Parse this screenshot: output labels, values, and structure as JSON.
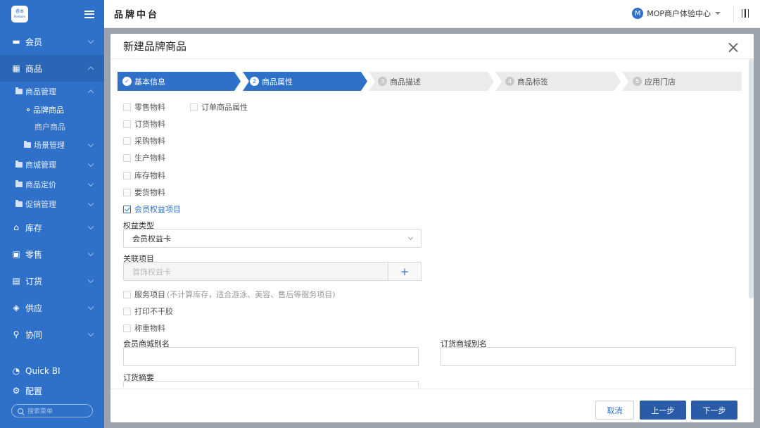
{
  "sidebar": {
    "logo_text_top": "睿本",
    "logo_text_bottom": "Reebom",
    "items": [
      {
        "label": "会员",
        "icon": "card-icon"
      },
      {
        "label": "商品",
        "icon": "grid-icon"
      },
      {
        "label": "库存",
        "icon": "warehouse-icon"
      },
      {
        "label": "零售",
        "icon": "store-icon"
      },
      {
        "label": "订货",
        "icon": "document-icon"
      },
      {
        "label": "供应",
        "icon": "layers-icon"
      },
      {
        "label": "协同",
        "icon": "collab-icon"
      }
    ],
    "product_sub": {
      "group": "商品管理",
      "leaf_selected": "品牌商品",
      "leaf_other": "商户商品",
      "scene": "场景管理",
      "mall": "商城管理",
      "pricing": "商品定价",
      "promo": "促销管理"
    },
    "bottom": {
      "quickbi": "Quick BI",
      "config": "配置",
      "search_placeholder": "搜索菜单"
    }
  },
  "header": {
    "title": "品牌中台",
    "user_avatar": "M",
    "user_name": "MOP商户体验中心"
  },
  "modal": {
    "title": "新建品牌商品",
    "steps": [
      {
        "num": "1",
        "label": "基本信息",
        "state": "done"
      },
      {
        "num": "2",
        "label": "商品属性",
        "state": "current"
      },
      {
        "num": "3",
        "label": "商品描述",
        "state": "todo"
      },
      {
        "num": "4",
        "label": "商品标签",
        "state": "todo"
      },
      {
        "num": "5",
        "label": "应用门店",
        "state": "todo"
      }
    ],
    "checkboxes": {
      "retail": "零售物料",
      "order_attr": "订单商品属性",
      "order": "订货物料",
      "purchase": "采购物料",
      "production": "生产物料",
      "inventory": "库存物料",
      "requisition": "要货物料",
      "member_benefit": "会员权益项目",
      "service": "服务项目",
      "service_note": "(不计算库存，适合游泳、美容、售后等服务项目)",
      "print": "打印不干胶",
      "weigh": "称重物料"
    },
    "benefit_type_label": "权益类型",
    "benefit_type_value": "会员权益卡",
    "related_label": "关联项目",
    "related_value": "首饰权益卡",
    "mall_alias_label": "会员商城别名",
    "order_alias_label": "订货商城别名",
    "summary_label": "订货摘要",
    "buttons": {
      "cancel": "取消",
      "prev": "上一步",
      "next": "下一步"
    }
  },
  "colors": {
    "primary": "#2f71c8",
    "button": "#2a5ba8",
    "overlay": "#9aa3ad"
  }
}
